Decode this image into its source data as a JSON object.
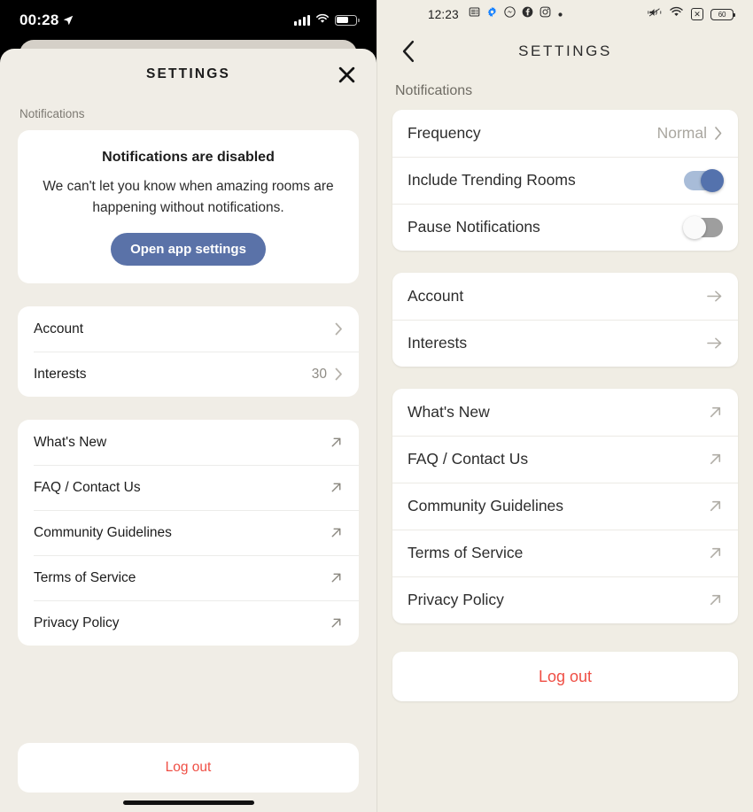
{
  "ios": {
    "status_bar": {
      "time": "00:28",
      "location_icon": "location-arrow-icon",
      "signal_icon": "cellular-signal-icon",
      "wifi_icon": "wifi-icon",
      "battery_icon": "battery-icon"
    },
    "header": {
      "title": "SETTINGS",
      "close_icon": "close-icon"
    },
    "section_label": "Notifications",
    "notification_card": {
      "title": "Notifications are disabled",
      "description": "We can't let you know when amazing rooms are happening without notifications.",
      "button_label": "Open app settings",
      "button_color": "#5a72a8"
    },
    "account_rows": [
      {
        "label": "Account",
        "value": "",
        "icon": "chevron-right-icon"
      },
      {
        "label": "Interests",
        "value": "30",
        "icon": "chevron-right-icon"
      }
    ],
    "link_rows": [
      {
        "label": "What's New",
        "icon": "external-link-icon"
      },
      {
        "label": "FAQ / Contact Us",
        "icon": "external-link-icon"
      },
      {
        "label": "Community Guidelines",
        "icon": "external-link-icon"
      },
      {
        "label": "Terms of Service",
        "icon": "external-link-icon"
      },
      {
        "label": "Privacy Policy",
        "icon": "external-link-icon"
      }
    ],
    "logout_label": "Log out",
    "logout_color": "#ef4e44",
    "background_color": "#f0ede6"
  },
  "android": {
    "status_bar": {
      "time": "12:23",
      "notification_icons": [
        "news-icon",
        "settings-gear-icon",
        "messenger-icon",
        "facebook-icon",
        "instagram-icon",
        "more-dot-icon"
      ],
      "vibrate_icon": "vibrate-icon",
      "wifi_icon": "wifi-icon",
      "no-sim_icon": "no-sim-icon",
      "battery_level": "60"
    },
    "header": {
      "title": "SETTINGS",
      "back_icon": "chevron-left-icon"
    },
    "section_label": "Notifications",
    "notification_rows": [
      {
        "label": "Frequency",
        "value": "Normal",
        "control": "chevron-right-icon"
      },
      {
        "label": "Include Trending Rooms",
        "value": "",
        "control": "toggle-on"
      },
      {
        "label": "Pause Notifications",
        "value": "",
        "control": "toggle-off"
      }
    ],
    "account_rows": [
      {
        "label": "Account",
        "icon": "arrow-right-icon"
      },
      {
        "label": "Interests",
        "icon": "arrow-right-icon"
      }
    ],
    "link_rows": [
      {
        "label": "What's New",
        "icon": "external-link-icon"
      },
      {
        "label": "FAQ / Contact Us",
        "icon": "external-link-icon"
      },
      {
        "label": "Community Guidelines",
        "icon": "external-link-icon"
      },
      {
        "label": "Terms of Service",
        "icon": "external-link-icon"
      },
      {
        "label": "Privacy Policy",
        "icon": "external-link-icon"
      }
    ],
    "logout_label": "Log out",
    "logout_color": "#ef4e44",
    "toggle_on_color": "#5472ad",
    "toggle_off_color": "#9e9e9e",
    "background_color": "#f0ede4"
  }
}
